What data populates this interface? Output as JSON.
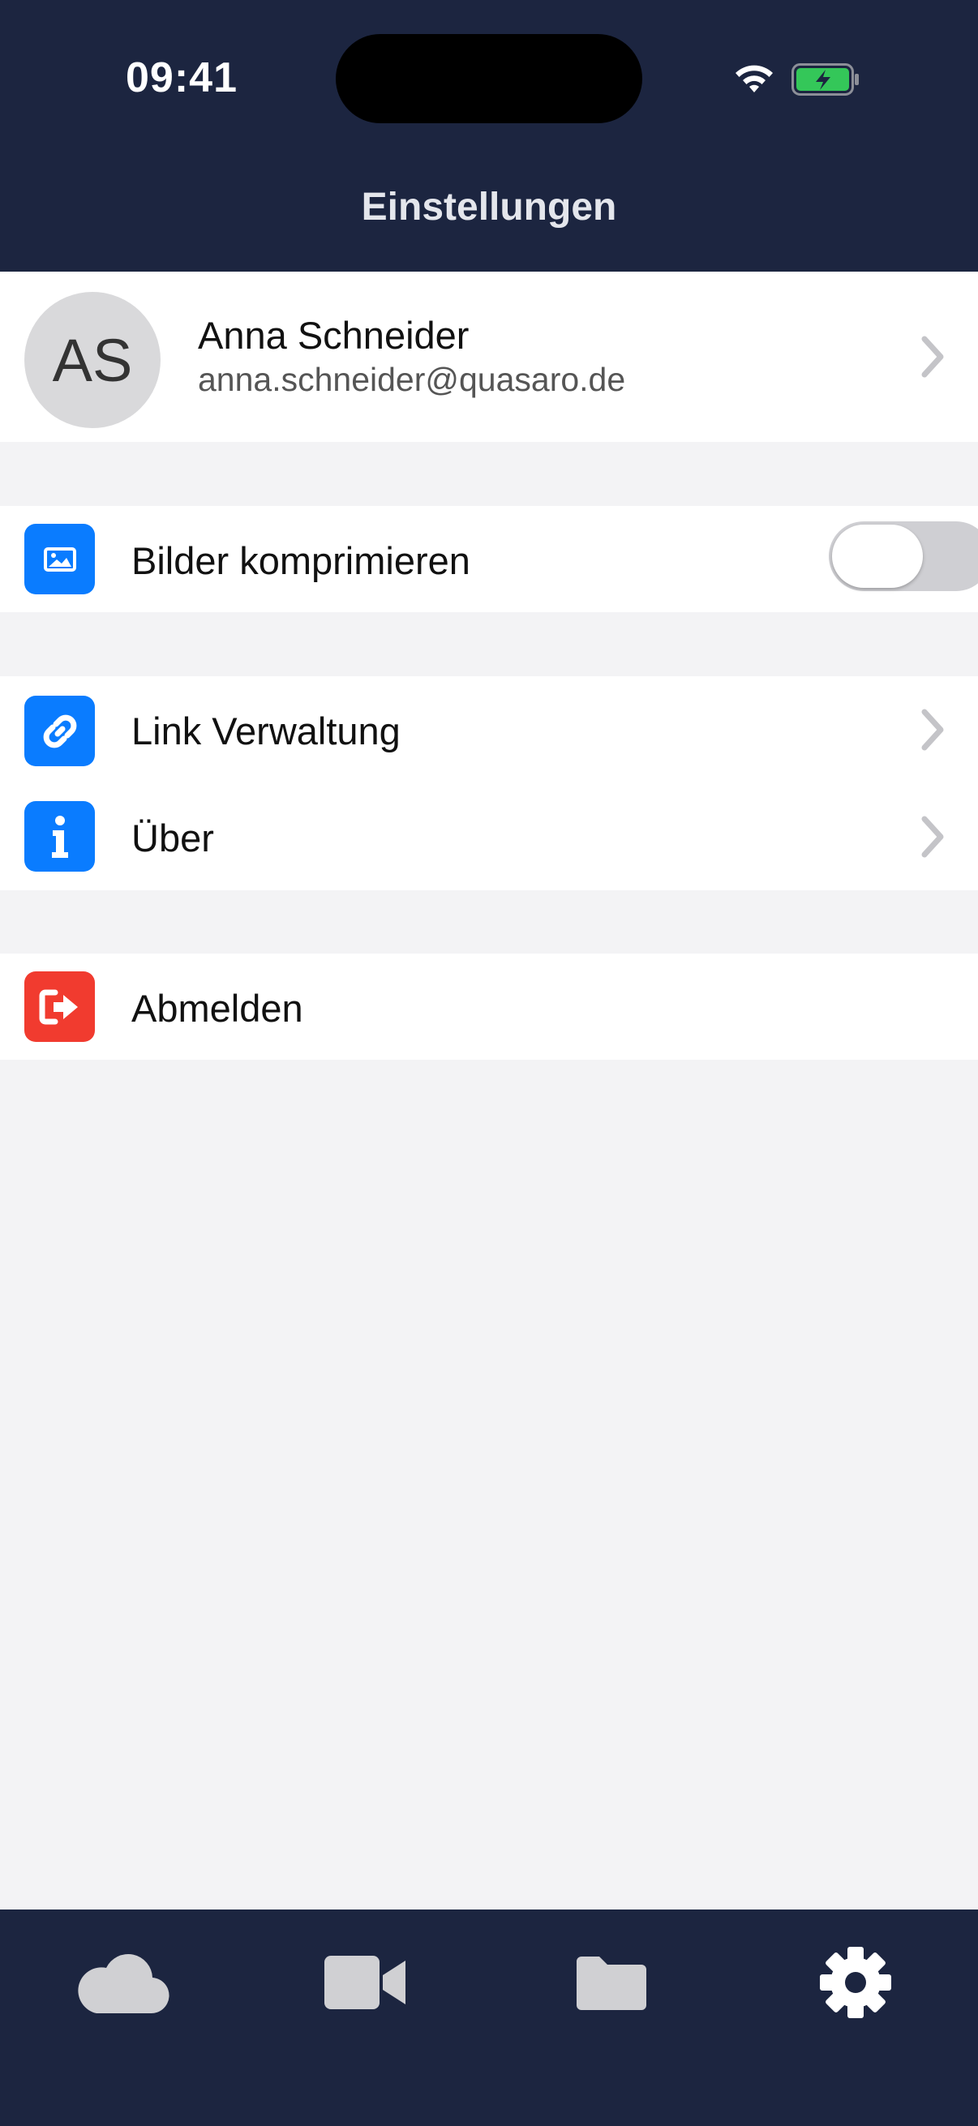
{
  "status_bar": {
    "time": "09:41",
    "icons": [
      "wifi-icon",
      "battery-charging-icon"
    ]
  },
  "header": {
    "title": "Einstellungen"
  },
  "profile": {
    "initials": "AS",
    "name": "Anna Schneider",
    "email": "anna.schneider@quasaro.de"
  },
  "settings": {
    "compress_images": {
      "label": "Bilder komprimieren",
      "icon": "image-icon",
      "enabled": false
    },
    "link_management": {
      "label": "Link Verwaltung",
      "icon": "link-icon"
    },
    "about": {
      "label": "Über",
      "icon": "info-icon"
    },
    "logout": {
      "label": "Abmelden",
      "icon": "sign-out-icon"
    }
  },
  "tabs": [
    {
      "icon": "cloud-icon",
      "active": false
    },
    {
      "icon": "video-camera-icon",
      "active": false
    },
    {
      "icon": "folder-icon",
      "active": false
    },
    {
      "icon": "gear-icon",
      "active": true
    }
  ],
  "colors": {
    "header_bg": "#1c2540",
    "accent_blue": "#0a7cff",
    "danger_red": "#f13b2f",
    "tab_inactive": "#d0d0d3",
    "tab_active": "#ffffff"
  }
}
